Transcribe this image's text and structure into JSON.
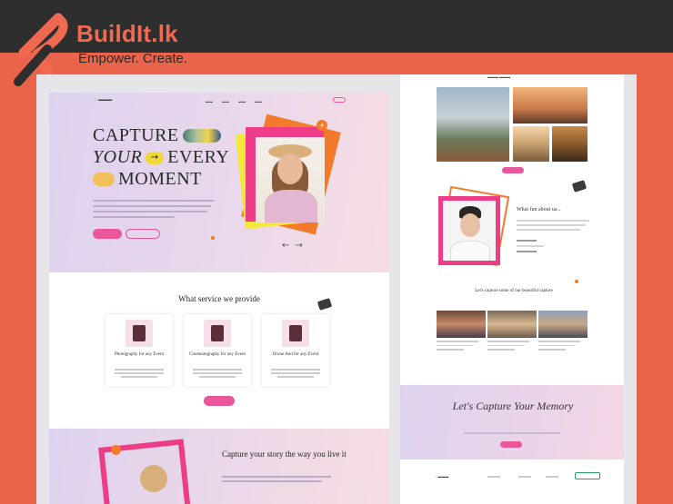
{
  "brand": {
    "name": "BuildIt.lk",
    "tagline": "Empower. Create.",
    "colors": {
      "brand_orange": "#e9644a",
      "topbar": "#2e2e2e"
    }
  },
  "hero": {
    "line1": "CAPTURE",
    "line2_italic": "YOUR",
    "line2_icon": "→",
    "line2_rest": "EVERY",
    "line3": "MOMENT",
    "badge_plus": "+"
  },
  "services": {
    "title": "What service we provide",
    "cards": [
      {
        "title": "Photography for any Event"
      },
      {
        "title": "Cinematography for any Event"
      },
      {
        "title": "Drone And for any Event"
      }
    ]
  },
  "story": {
    "title": "Capture your story the way you live it"
  },
  "right_page": {
    "about_title": "What fun about us...",
    "capture_title": "Let's capture some of our beautiful capture",
    "cta_title": "Let's Capture Your Memory"
  },
  "accent_colors": {
    "pink": "#e9569a",
    "orange": "#f37a2a",
    "yellow": "#f5e83a"
  }
}
